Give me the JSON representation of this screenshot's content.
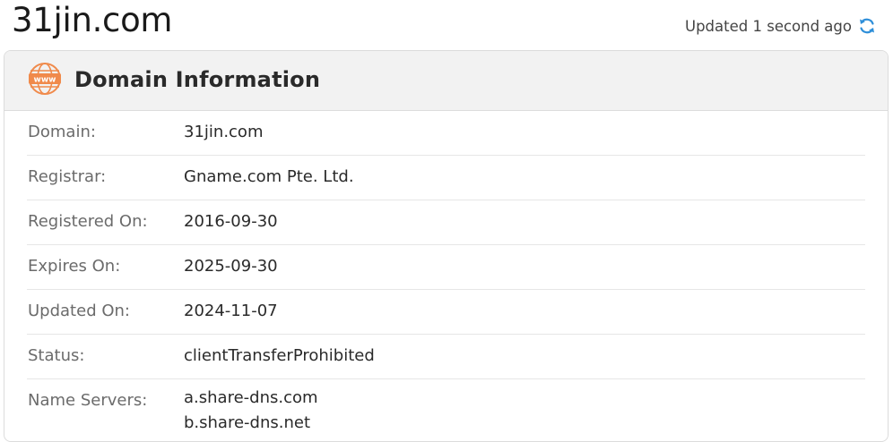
{
  "header": {
    "site_title": "31jin.com",
    "updated_text": "Updated 1 second ago",
    "refresh_icon": "refresh-icon",
    "accent_color": "#2f8fd9"
  },
  "card": {
    "icon": "www-icon",
    "icon_color": "#f08a4b",
    "title": "Domain Information",
    "rows": [
      {
        "label": "Domain:",
        "value": "31jin.com"
      },
      {
        "label": "Registrar:",
        "value": "Gname.com Pte. Ltd."
      },
      {
        "label": "Registered On:",
        "value": "2016-09-30"
      },
      {
        "label": "Expires On:",
        "value": "2025-09-30"
      },
      {
        "label": "Updated On:",
        "value": "2024-11-07"
      },
      {
        "label": "Status:",
        "value": "clientTransferProhibited"
      }
    ],
    "name_servers": {
      "label": "Name Servers:",
      "values": [
        "a.share-dns.com",
        "b.share-dns.net"
      ]
    }
  }
}
